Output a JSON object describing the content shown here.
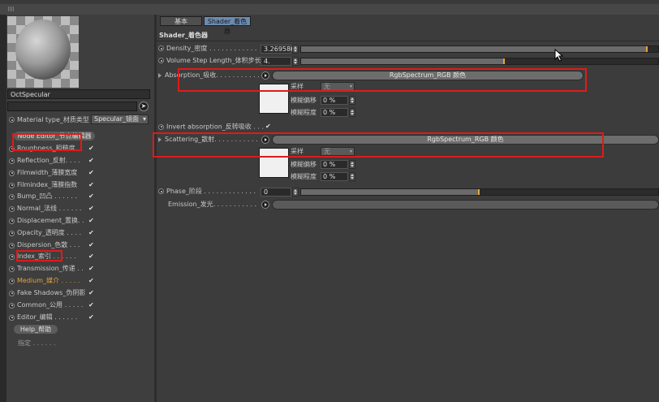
{
  "window": {
    "grip_icon": "grip-dots-icon"
  },
  "material": {
    "name": "OctSpecular",
    "type_label": "Material type_材质类型",
    "type_value": "Specular_镜面"
  },
  "left": {
    "node_editor_label": "Node Editor_节点编辑器",
    "channels": [
      {
        "label": "Roughness_粗糙度",
        "checked": "✔",
        "orange": false
      },
      {
        "label": "Reflection_反射. . . .",
        "checked": "✔",
        "orange": false
      },
      {
        "label": "Filmwidth_薄膜宽度",
        "checked": "✔",
        "orange": false
      },
      {
        "label": "Filmindex_薄膜指数",
        "checked": "✔",
        "orange": false
      },
      {
        "label": "Bump_凹凸 . . . . . .",
        "checked": "✔",
        "orange": false
      },
      {
        "label": "Normal_法线 . . . . . .",
        "checked": "✔",
        "orange": false
      },
      {
        "label": "Displacement_置换. .",
        "checked": "✔",
        "orange": false
      },
      {
        "label": "Opacity_透明度 . . . .",
        "checked": "✔",
        "orange": false
      },
      {
        "label": "Dispersion_色散 . . .",
        "checked": "✔",
        "orange": false
      },
      {
        "label": "Index_索引 . . . . . .",
        "checked": "✔",
        "orange": false
      },
      {
        "label": "Transmission_传递 . .",
        "checked": "✔",
        "orange": false
      },
      {
        "label": "Medium_媒介 . . . . .",
        "checked": "✔",
        "orange": true
      },
      {
        "label": "Fake Shadows_伪阴影",
        "checked": "✔",
        "orange": false
      },
      {
        "label": "Common_公用 . . . . .",
        "checked": "✔",
        "orange": false
      },
      {
        "label": "Editor_编辑 . . . . . .",
        "checked": "✔",
        "orange": false
      }
    ],
    "help_label": "Help_帮助",
    "assign_label": "指定 . . . . . ."
  },
  "tabs": {
    "basic": "基本",
    "shader": "Shader_着色器"
  },
  "shader": {
    "section_title": "Shader_着色器",
    "density_label": "Density_密度 . . . . . . . . . . . .",
    "density_value": "3.269586",
    "density_fill": 0.97,
    "vsl_label": "Volume Step Length_体积步长",
    "vsl_value": "4.",
    "vsl_fill": 0.57,
    "absorption_label": "Absorption_吸收. . . . . . . . . . .",
    "absorption_spectrum": "RgbSpectrum_RGB 颜色",
    "invert_label": "Invert absorption_反转吸收 . . .",
    "invert_checked": "✔",
    "scattering_label": "Scattering_散射. . . . . . . . . . .",
    "scattering_spectrum": "RgbSpectrum_RGB 颜色",
    "sample_label": "采样",
    "sample_value": "无",
    "blur_offset_label": "模糊偏移",
    "blur_offset_value": "0 %",
    "blur_degree_label": "模糊程度",
    "blur_degree_value": "0 %",
    "phase_label": "Phase_阶段 . . . . . . . . . . . . .",
    "phase_value": "0",
    "phase_fill": 0.5,
    "emission_label": "Emission_发光. . . . . . . . . . ."
  }
}
